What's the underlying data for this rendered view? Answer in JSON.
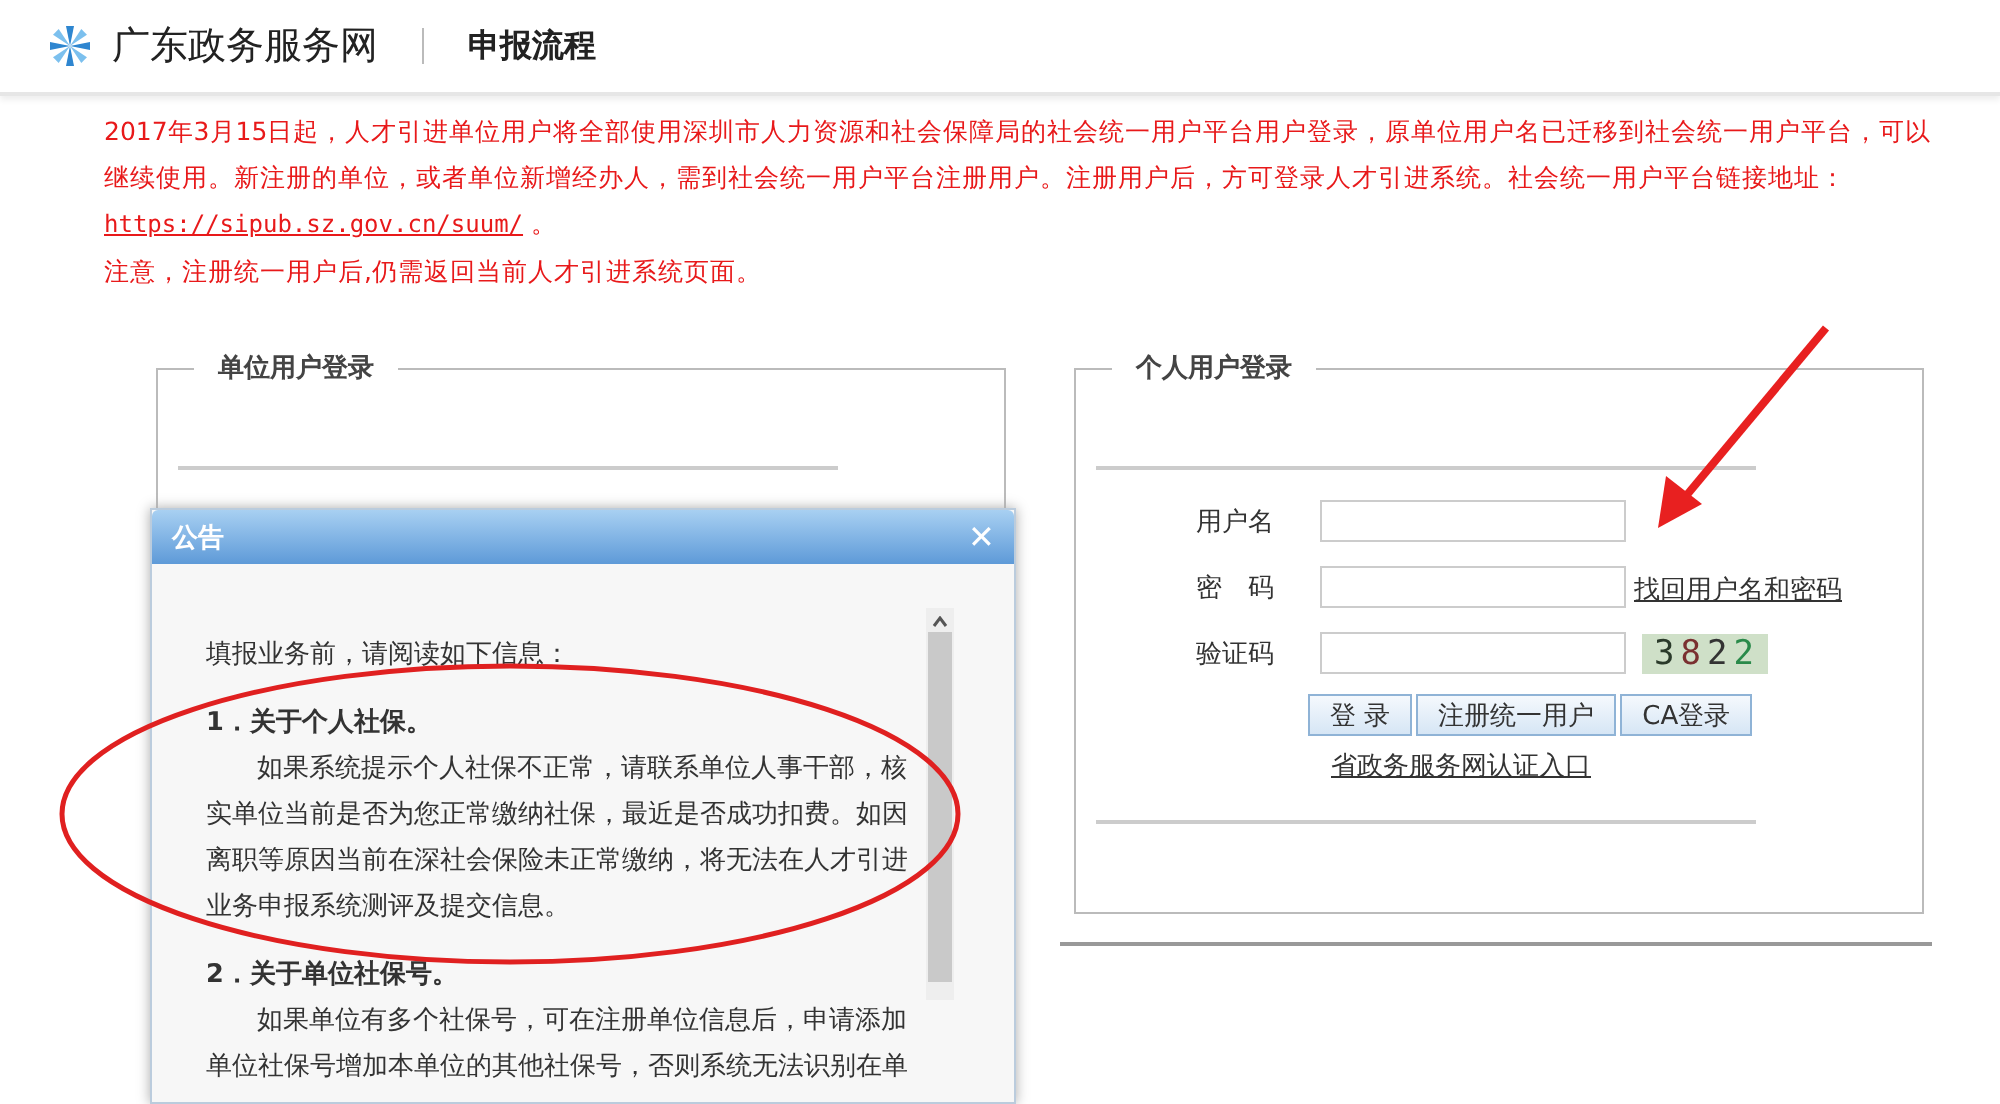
{
  "header": {
    "site_name": "广东政务服务网",
    "page_title": "申报流程"
  },
  "notice": {
    "before_link": "2017年3月15日起，人才引进单位用户将全部使用深圳市人力资源和社会保障局的社会统一用户平台用户登录，原单位用户名已迁移到社会统一用户平台，可以继续使用。新注册的单位，或者单位新增经办人，需到社会统一用户平台注册用户。注册用户后，方可登录人才引进系统。社会统一用户平台链接地址：",
    "link": "https://sipub.sz.gov.cn/suum/",
    "after_link": "。",
    "note": "注意，注册统一用户后,仍需返回当前人才引进系统页面。"
  },
  "unit_login": {
    "legend": "单位用户登录"
  },
  "personal_login": {
    "legend": "个人用户登录",
    "fields": [
      {
        "label": "用户名"
      },
      {
        "label": "密　码",
        "link": "找回用户名和密码"
      },
      {
        "label": "验证码",
        "captcha": "3822"
      }
    ],
    "buttons": [
      "登 录",
      "注册统一用户",
      "CA登录"
    ],
    "portal_link": "省政务服务网认证入口"
  },
  "dialog": {
    "title": "公告",
    "close": "✕",
    "intro": "填报业务前，请阅读如下信息：",
    "sections": [
      {
        "heading": "1．关于个人社保。",
        "body": "如果系统提示个人社保不正常，请联系单位人事干部，核实单位当前是否为您正常缴纳社保，最近是否成功扣费。如因离职等原因当前在深社会保险未正常缴纳，将无法在人才引进业务申报系统测评及提交信息。"
      },
      {
        "heading": "2．关于单位社保号。",
        "body": "如果单位有多个社保号，可在注册单位信息后，申请添加单位社保号增加本单位的其他社保号，否则系统无法识别在单"
      }
    ]
  }
}
